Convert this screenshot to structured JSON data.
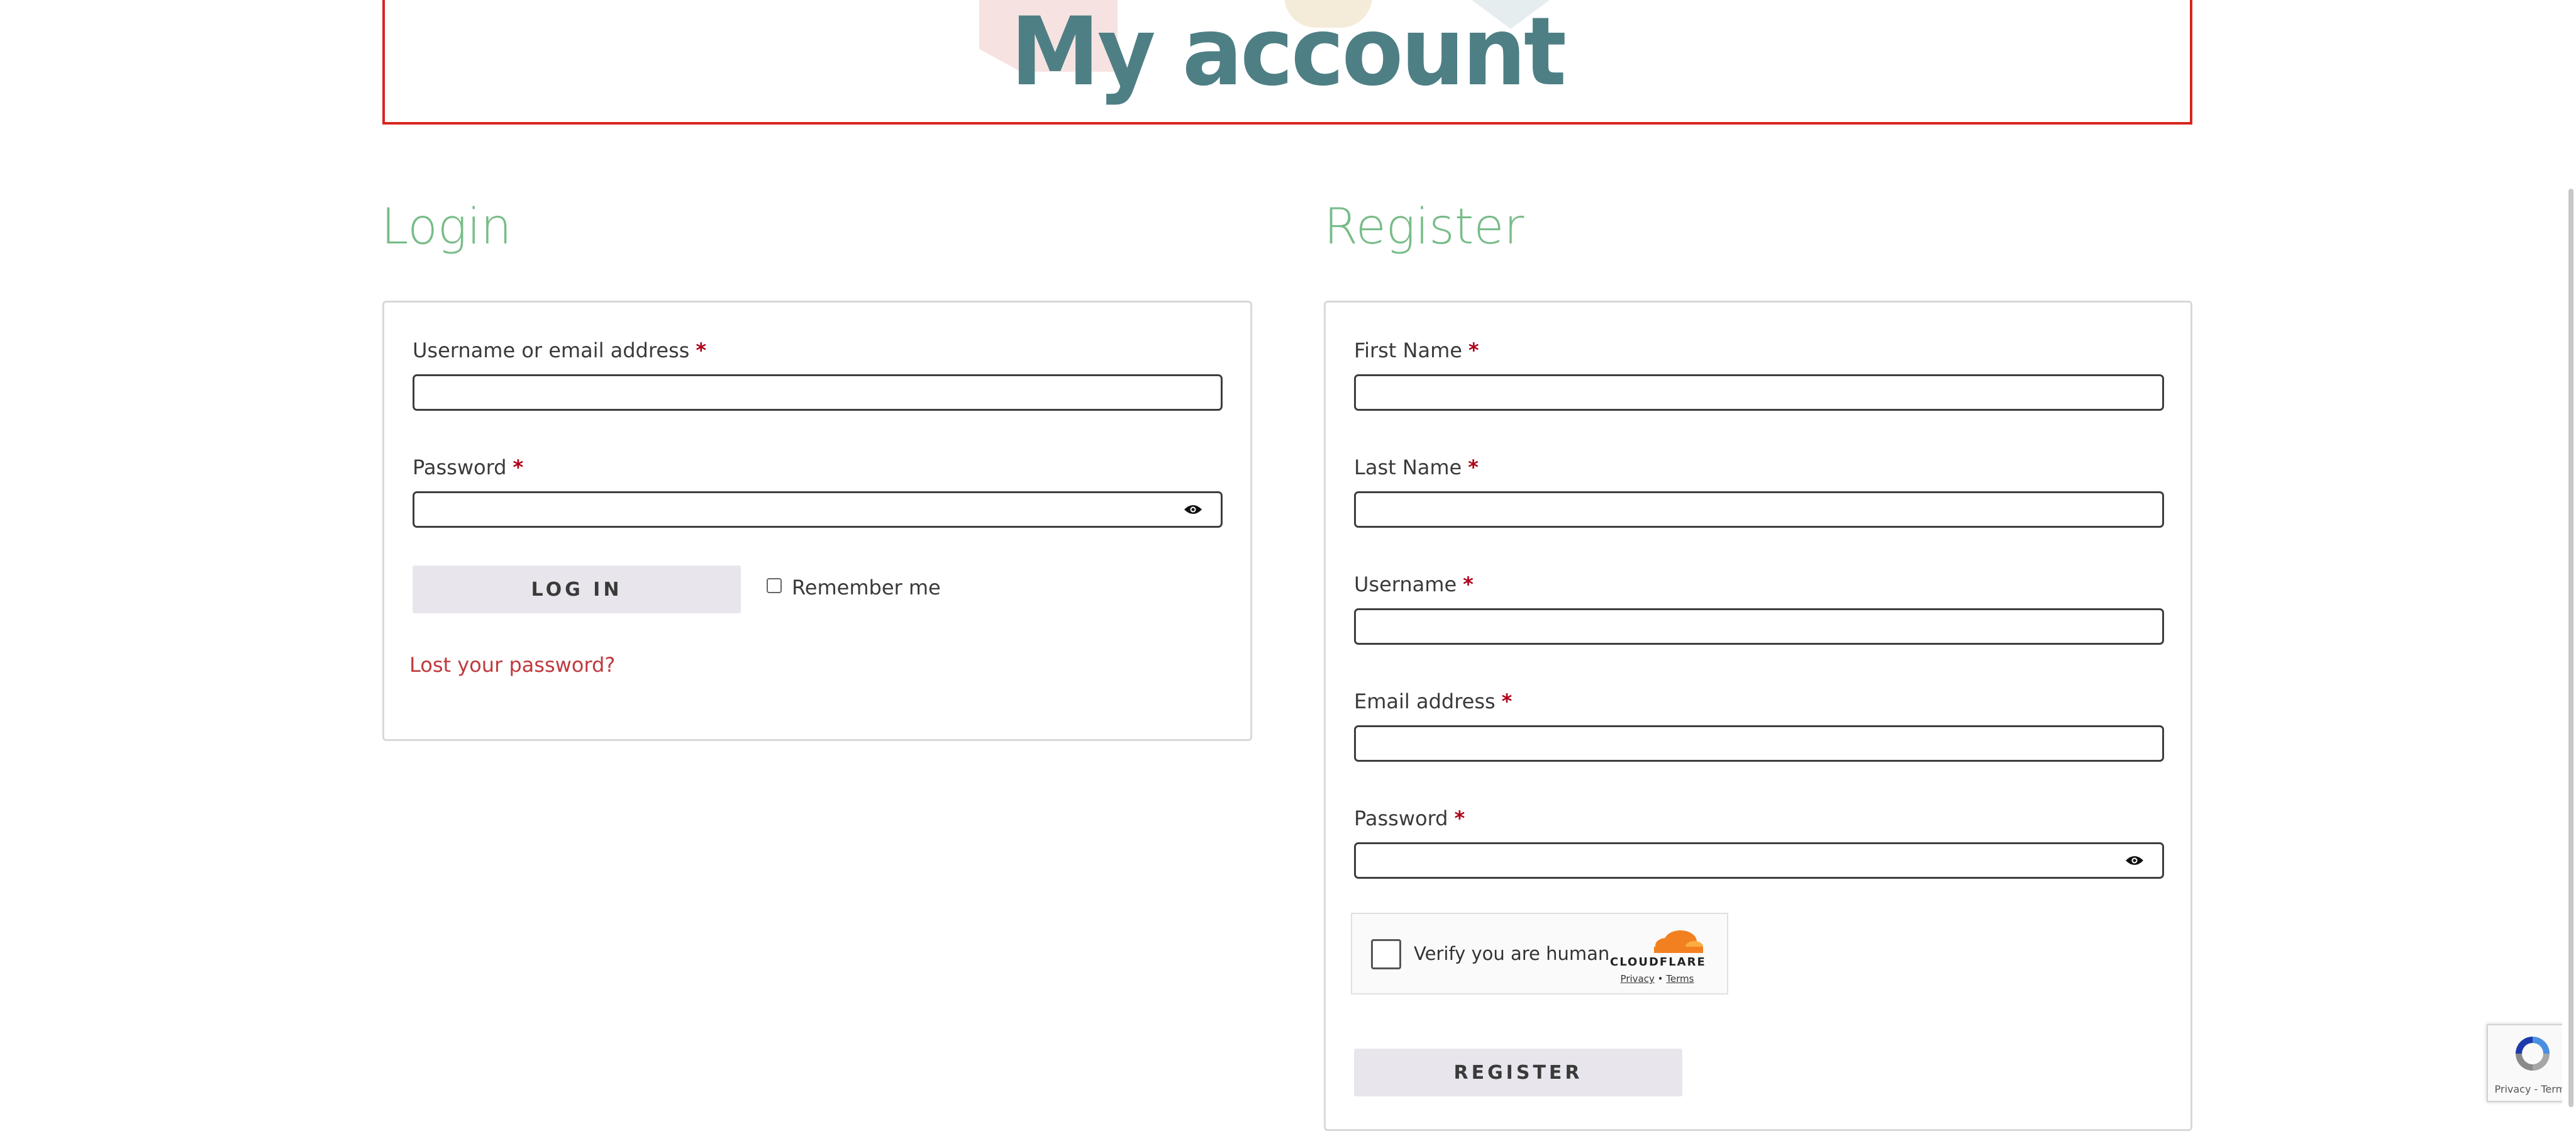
{
  "header": {
    "title": "My account"
  },
  "login": {
    "heading": "Login",
    "username_label": "Username or email address",
    "password_label": "Password",
    "required_mark": "*",
    "login_button": "LOG IN",
    "remember_label": "Remember me",
    "lost_password_link": "Lost your password?",
    "username_value": "",
    "password_value": ""
  },
  "register": {
    "heading": "Register",
    "first_name_label": "First Name",
    "last_name_label": "Last Name",
    "username_label": "Username",
    "email_label": "Email address",
    "password_label": "Password",
    "required_mark": "*",
    "register_button": "REGISTER",
    "first_name_value": "",
    "last_name_value": "",
    "username_value": "",
    "email_value": "",
    "password_value": ""
  },
  "captcha": {
    "label": "Verify you are human",
    "brand": "CLOUDFLARE",
    "privacy_link": "Privacy",
    "separator": "•",
    "terms_link": "Terms"
  },
  "recaptcha": {
    "text": "Privacy - Terms"
  },
  "icons": {
    "password_toggle": "eye-icon",
    "cloudflare_logo": "cloud-icon",
    "recaptcha_logo": "recaptcha-icon"
  },
  "colors": {
    "title": "#4e7f85",
    "section_heading": "#78bc88",
    "required": "#b0001a",
    "link": "#c0393d",
    "hero_border": "#d9251c",
    "button_bg": "#e8e6ec"
  }
}
